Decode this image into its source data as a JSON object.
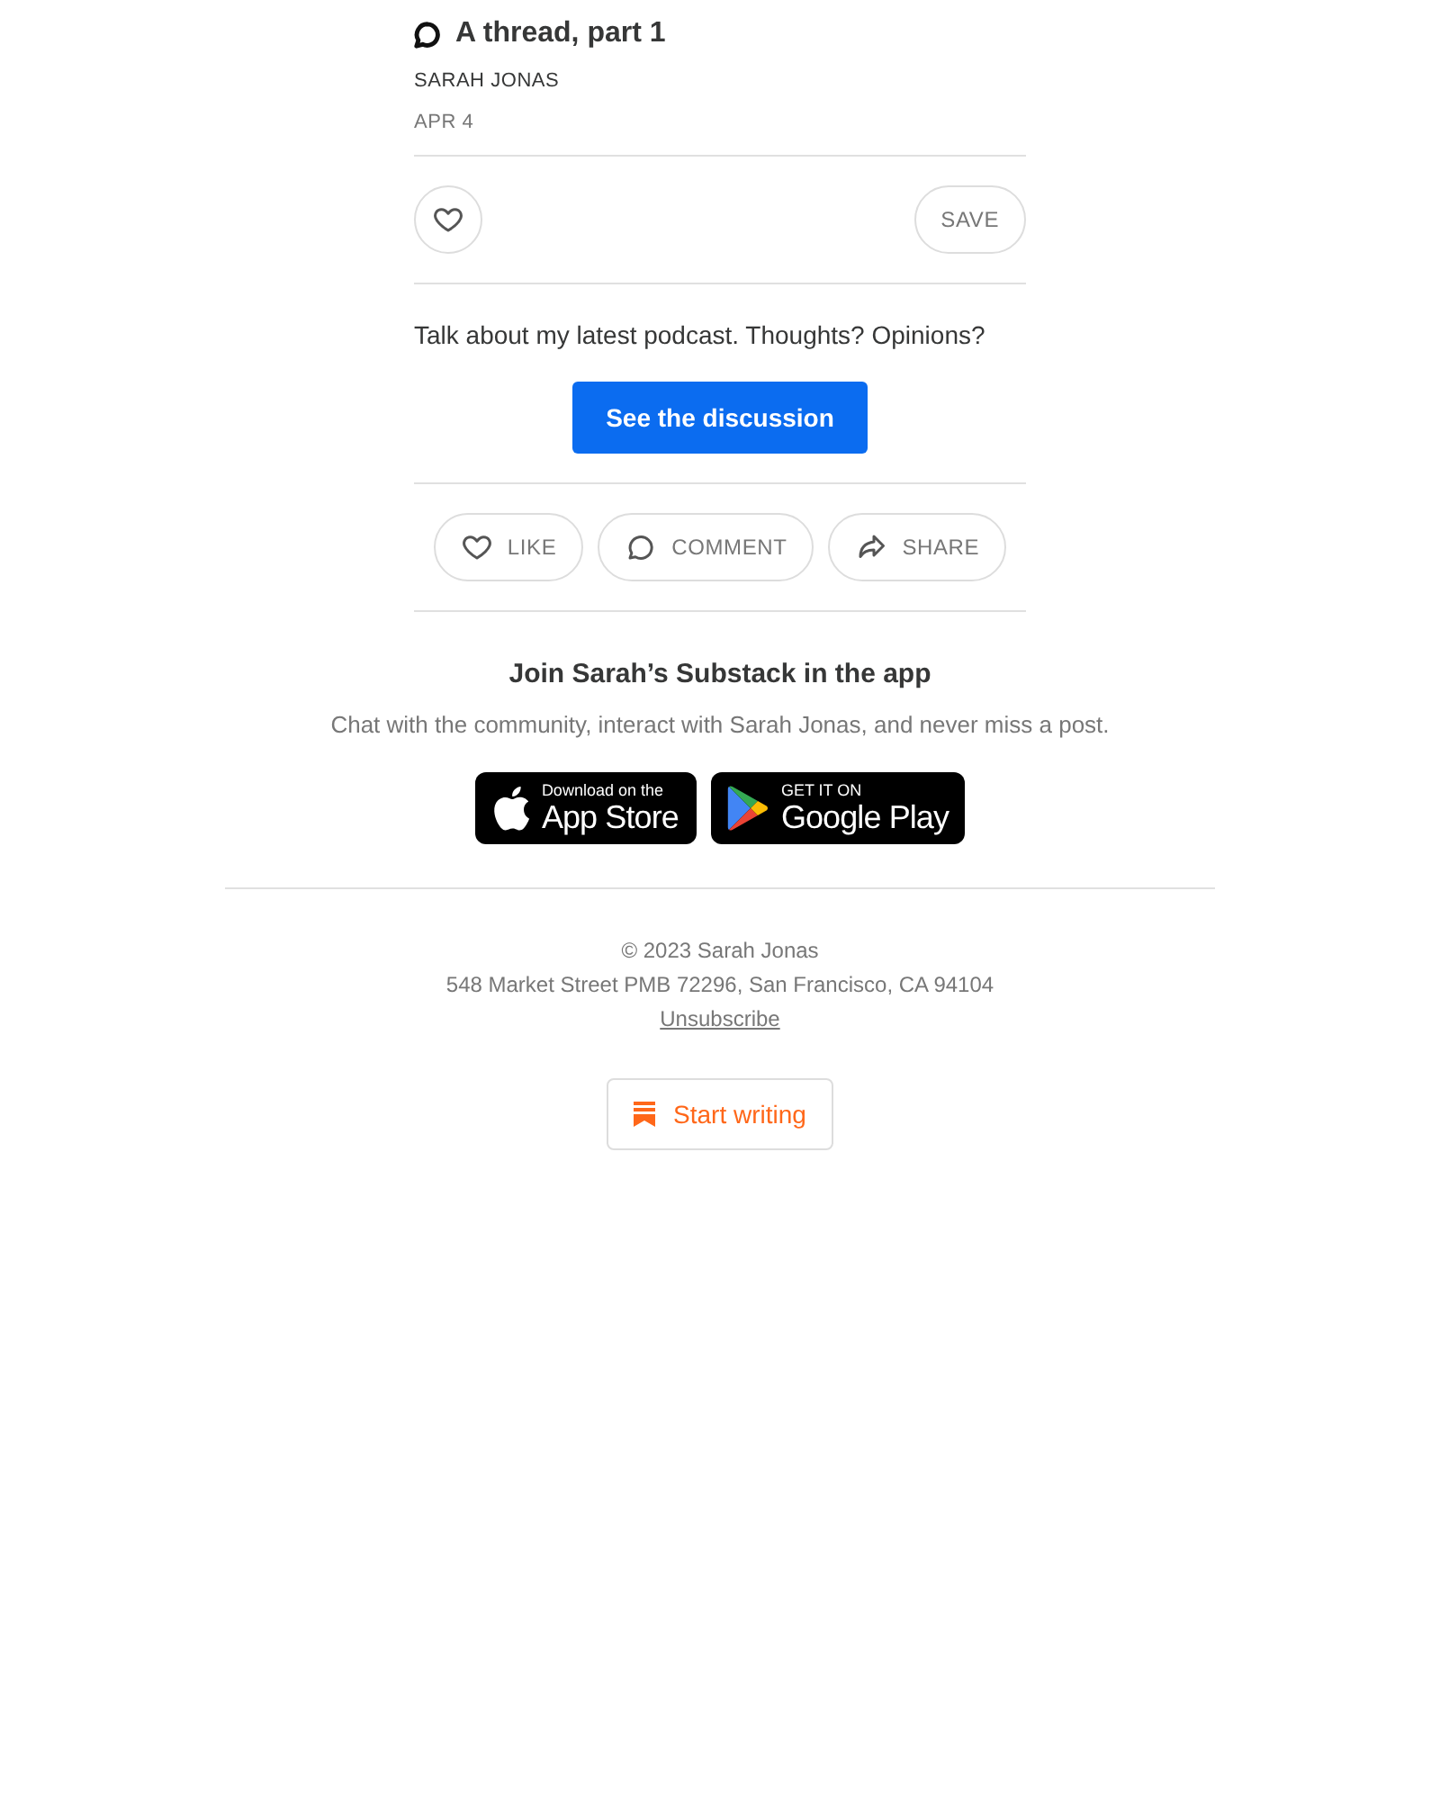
{
  "post": {
    "title": "A thread, part 1",
    "author": "SARAH JONAS",
    "date": "APR 4",
    "save_label": "SAVE",
    "body": "Talk about my latest podcast. Thoughts? Opinions?",
    "cta": "See the discussion"
  },
  "actions": [
    {
      "kind": "like",
      "label": "LIKE"
    },
    {
      "kind": "comment",
      "label": "COMMENT"
    },
    {
      "kind": "share",
      "label": "SHARE"
    }
  ],
  "app_promo": {
    "title": "Join Sarah’s Substack in the app",
    "subtitle": "Chat with the community, interact with Sarah Jonas, and never miss a post.",
    "badges": [
      {
        "kind": "apple",
        "small": "Download on the",
        "big": "App Store"
      },
      {
        "kind": "google",
        "small": "GET IT ON",
        "big": "Google Play"
      }
    ]
  },
  "footer": {
    "copyright": "© 2023 Sarah Jonas",
    "address": "548 Market Street PMB 72296, San Francisco, CA 94104",
    "unsubscribe": "Unsubscribe",
    "start_writing": "Start writing"
  }
}
